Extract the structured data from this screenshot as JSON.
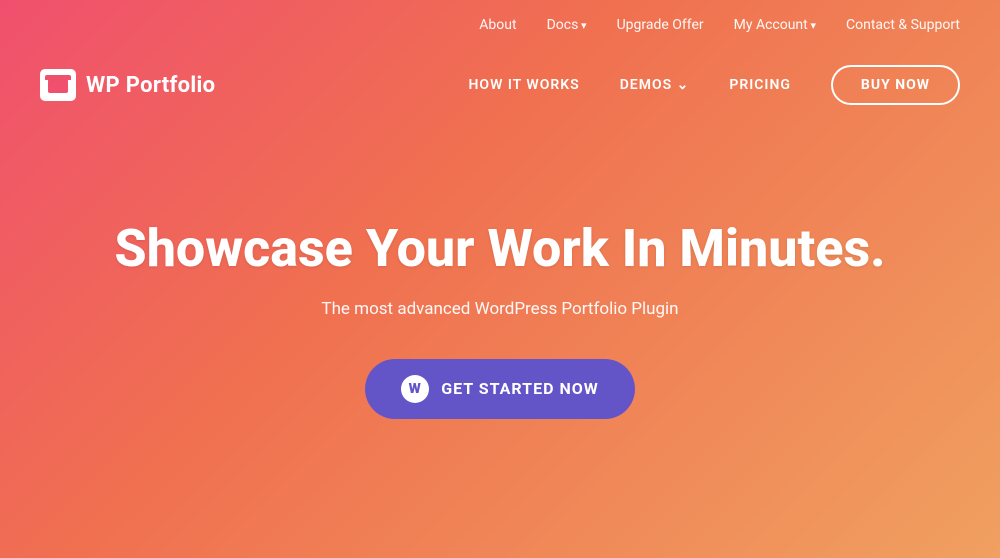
{
  "top_bar": {
    "links": [
      {
        "label": "About",
        "id": "about",
        "has_arrow": false
      },
      {
        "label": "Docs",
        "id": "docs",
        "has_arrow": true
      },
      {
        "label": "Upgrade Offer",
        "id": "upgrade-offer",
        "has_arrow": false
      },
      {
        "label": "My Account",
        "id": "my-account",
        "has_arrow": true
      },
      {
        "label": "Contact & Support",
        "id": "contact-support",
        "has_arrow": false
      }
    ]
  },
  "logo": {
    "text": "WP Portfolio"
  },
  "nav": {
    "links": [
      {
        "label": "HOW IT WORKS",
        "id": "how-it-works",
        "has_arrow": false
      },
      {
        "label": "DEMOS",
        "id": "demos",
        "has_arrow": true
      },
      {
        "label": "PRICING",
        "id": "pricing",
        "has_arrow": false
      }
    ],
    "cta_label": "BUY NOW"
  },
  "hero": {
    "title": "Showcase Your Work In Minutes.",
    "subtitle": "The most advanced WordPress Portfolio Plugin",
    "cta_label": "GET STARTED NOW",
    "wp_icon_char": "W"
  }
}
